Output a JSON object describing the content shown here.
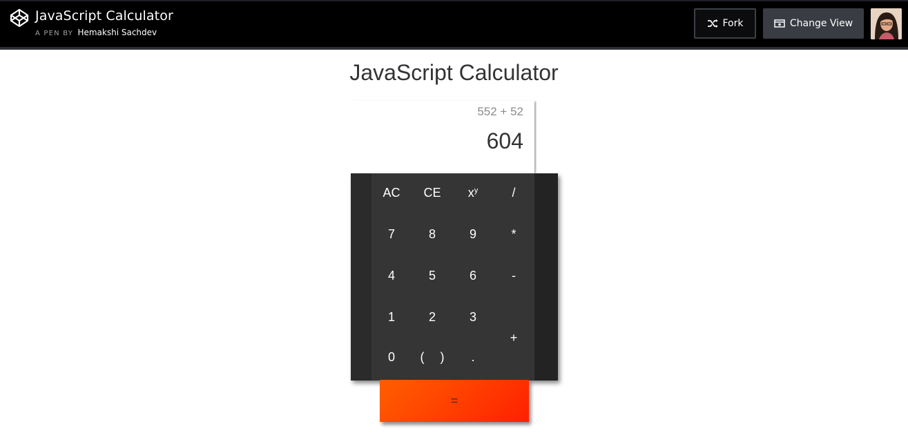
{
  "header": {
    "pen_title": "JavaScript Calculator",
    "pen_by": "A PEN BY",
    "author": "Hemakshi Sachdev",
    "fork_label": "Fork",
    "change_view_label": "Change View"
  },
  "page": {
    "title": "JavaScript Calculator"
  },
  "display": {
    "expression": "552 + 52",
    "result": "604"
  },
  "keys": {
    "ac": "AC",
    "ce": "CE",
    "power_base": "x",
    "power_exp": "y",
    "divide": "/",
    "seven": "7",
    "eight": "8",
    "nine": "9",
    "multiply": "*",
    "four": "4",
    "five": "5",
    "six": "6",
    "minus": "-",
    "one": "1",
    "two": "2",
    "three": "3",
    "plus": "+",
    "zero": "0",
    "open_paren": "(",
    "close_paren": ")",
    "decimal": ".",
    "equals": "="
  },
  "colors": {
    "topbar": "#000000",
    "keypad": "#353535",
    "equals_start": "#ff5e00",
    "equals_end": "#ff2000"
  }
}
